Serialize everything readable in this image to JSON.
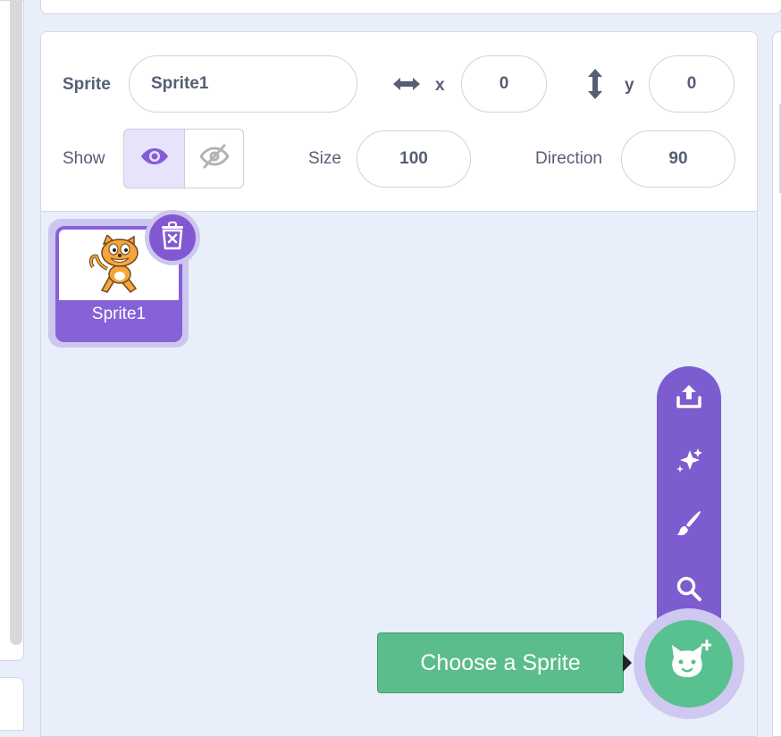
{
  "sprite_info": {
    "sprite_label": "Sprite",
    "sprite_name": "Sprite1",
    "x_label": "x",
    "x_value": "0",
    "y_label": "y",
    "y_value": "0",
    "show_label": "Show",
    "size_label": "Size",
    "size_value": "100",
    "direction_label": "Direction",
    "direction_value": "90"
  },
  "sprites": [
    {
      "name": "Sprite1",
      "selected": true,
      "thumbnail_icon": "cat-costume-icon"
    }
  ],
  "sprite_menu": {
    "items": [
      {
        "icon": "upload-icon",
        "action": "Upload Sprite"
      },
      {
        "icon": "surprise-icon",
        "action": "Surprise"
      },
      {
        "icon": "paint-icon",
        "action": "Paint"
      },
      {
        "icon": "search-icon",
        "action": "Choose"
      }
    ],
    "main_icon": "add-sprite-cat-icon",
    "tooltip": "Choose a Sprite"
  },
  "colors": {
    "accent": "#855cd6",
    "menu": "#7c5ccf",
    "add_button": "#59c08f",
    "background": "#e8effa"
  }
}
